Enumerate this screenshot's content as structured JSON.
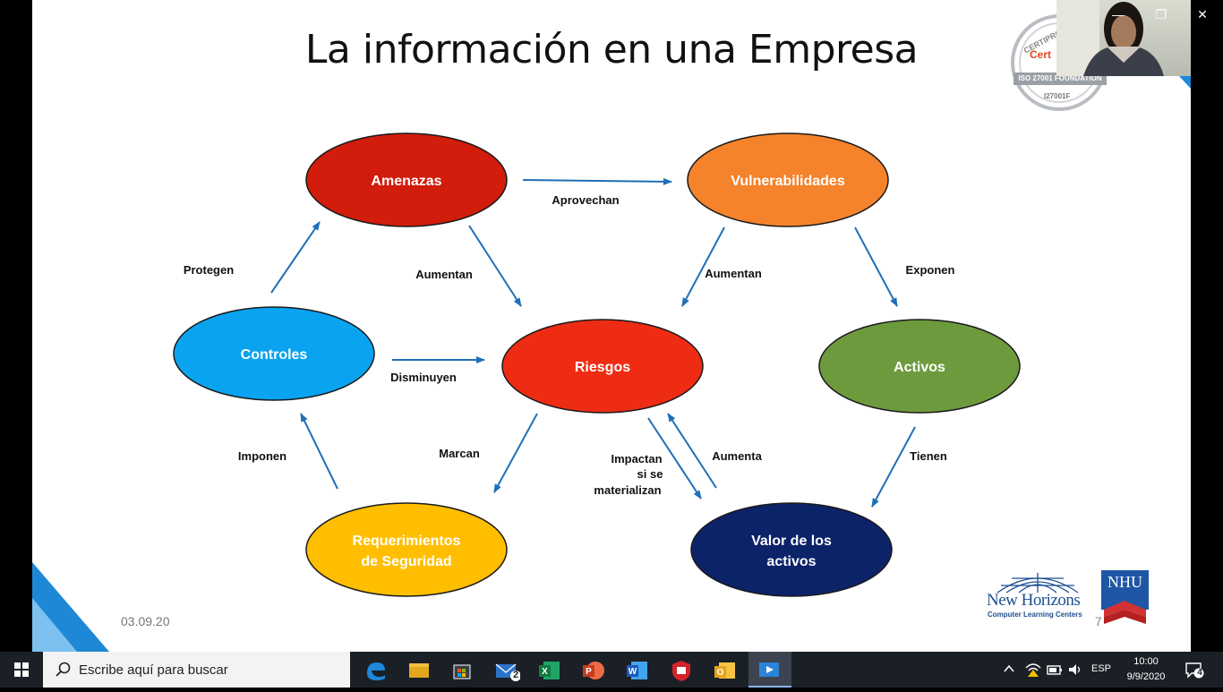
{
  "slide": {
    "title": "La información en una Empresa",
    "date": "03.09.20",
    "page_number": "7"
  },
  "diagram": {
    "nodes": [
      {
        "id": "amenazas",
        "label": "Amenazas",
        "color": "#d21c0c"
      },
      {
        "id": "vulnerabilidades",
        "label": "Vulnerabilidades",
        "color": "#f5832b"
      },
      {
        "id": "controles",
        "label": "Controles",
        "color": "#0aa3ef"
      },
      {
        "id": "riesgos",
        "label": "Riesgos",
        "color": "#ee2c13"
      },
      {
        "id": "activos",
        "label": "Activos",
        "color": "#6e9a3e"
      },
      {
        "id": "requerimientos",
        "label_line1": "Requerimientos",
        "label_line2": "de Seguridad",
        "color": "#ffbe00"
      },
      {
        "id": "valor",
        "label_line1": "Valor de los",
        "label_line2": "activos",
        "color": "#0c2369"
      }
    ],
    "edge_labels": {
      "aprovechan": "Aprovechan",
      "protegen": "Protegen",
      "aumentan_left": "Aumentan",
      "aumentan_right": "Aumentan",
      "exponen": "Exponen",
      "disminuyen": "Disminuyen",
      "imponen": "Imponen",
      "marcan": "Marcan",
      "impactan_line1": "Impactan",
      "impactan_line2": "si se",
      "impactan_line3": "materializan",
      "aumenta": "Aumenta",
      "tienen": "Tienen"
    },
    "arrow_color": "#1f6fb8"
  },
  "logos": {
    "new_horizons_name": "New Horizons",
    "new_horizons_sub": "Computer Learning Centers",
    "nhu": "NHU",
    "badge_top": "CERTIPROF",
    "badge_brand": "Cert",
    "badge_band": "ISO 27001 FOUNDATION",
    "badge_code": "I27001F"
  },
  "taskbar": {
    "search_placeholder": "Escribe aquí para buscar",
    "mail_badge": "2",
    "language": "ESP",
    "time": "10:00",
    "date": "9/9/2020",
    "notification_count": "4"
  }
}
